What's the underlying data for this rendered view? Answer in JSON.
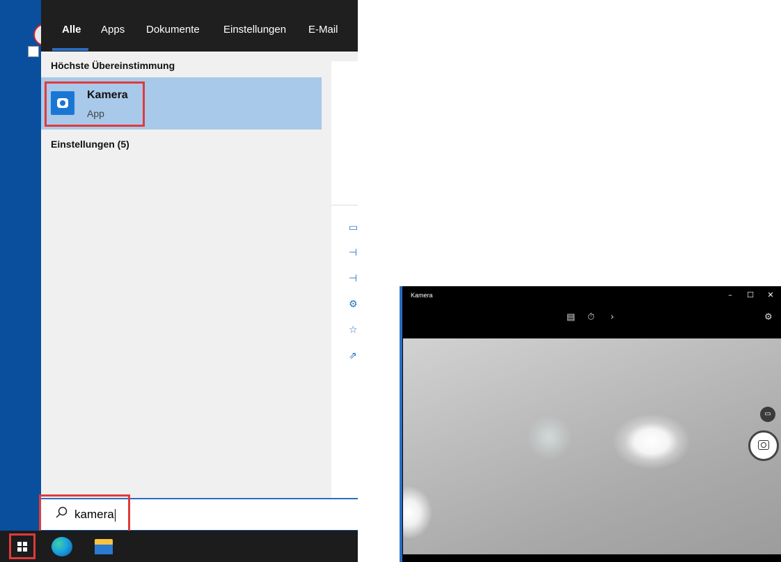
{
  "search": {
    "tabs": [
      "Alle",
      "Apps",
      "Dokumente",
      "Einstellungen",
      "E-Mail"
    ],
    "best_match_heading": "Höchste Übereinstimmung",
    "best_match": {
      "name": "Kamera",
      "type": "App",
      "icon": "camera-app-icon"
    },
    "settings_heading": "Einstellungen (5)",
    "query": "kamera",
    "preview_side_icons": [
      "window-icon",
      "pin-start-icon",
      "pin-taskbar-icon",
      "settings-icon",
      "rate-icon",
      "share-icon"
    ]
  },
  "taskbar": {
    "items": [
      "start-button",
      "edge-browser-icon",
      "file-explorer-icon"
    ]
  },
  "camera_window": {
    "title": "Kamera",
    "window_controls": [
      "minimize",
      "maximize",
      "close"
    ],
    "toolbar_icons": [
      "hdr-icon",
      "timer-icon",
      "more-chevron-icon",
      "settings-gear-icon"
    ],
    "capture_modes": [
      "video-mode-icon",
      "photo-shutter-icon"
    ]
  },
  "colors": {
    "accent": "#2b6cc4",
    "highlight": "#e03a3a",
    "selection": "#a8c9ea"
  }
}
